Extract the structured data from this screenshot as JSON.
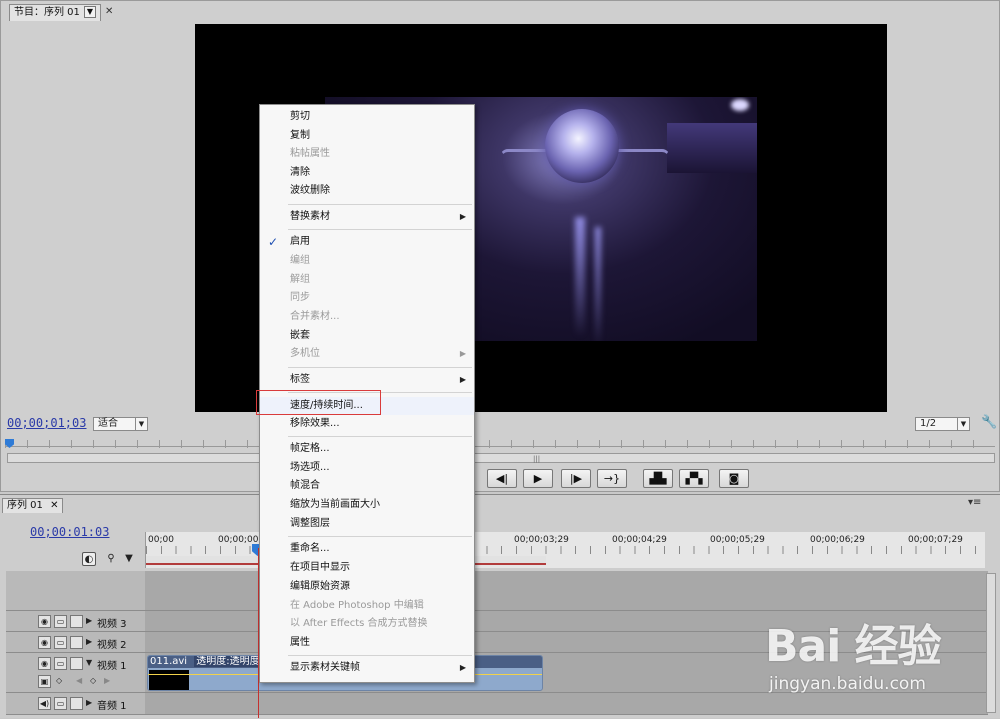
{
  "program_monitor": {
    "tab_title": "节目：序列 01",
    "timecode": "00;00;01;03",
    "fit_dropdown": "适合",
    "quality_dropdown": "1/2"
  },
  "transport": {
    "buttons": [
      "step-back",
      "play",
      "step-forward",
      "shuttle",
      "lift",
      "extract",
      "export-frame"
    ]
  },
  "timeline": {
    "tab_title": "序列 01",
    "timecode": "00;00:01:03",
    "ruler_labels": [
      "00;00",
      "00;00;00;29",
      "00;00;03;29",
      "00;00;04;29",
      "00;00;05;29",
      "00;00;06;29",
      "00;00;07;29"
    ],
    "tracks": [
      {
        "name": "视频 3"
      },
      {
        "name": "视频 2"
      },
      {
        "name": "视频 1"
      },
      {
        "name": "音频 1"
      }
    ],
    "clip": {
      "name": "011.avi",
      "effect": "透明度:透明度"
    }
  },
  "context_menu": {
    "items": [
      {
        "label": "剪切",
        "enabled": true
      },
      {
        "label": "复制",
        "enabled": true
      },
      {
        "label": "粘帖属性",
        "enabled": false
      },
      {
        "label": "清除",
        "enabled": true
      },
      {
        "label": "波纹删除",
        "enabled": true
      },
      {
        "label": "替换素材",
        "enabled": true,
        "submenu": true
      },
      {
        "label": "启用",
        "enabled": true,
        "checked": true
      },
      {
        "label": "编组",
        "enabled": false
      },
      {
        "label": "解组",
        "enabled": false
      },
      {
        "label": "同步",
        "enabled": false
      },
      {
        "label": "合并素材...",
        "enabled": false
      },
      {
        "label": "嵌套",
        "enabled": true
      },
      {
        "label": "多机位",
        "enabled": false,
        "submenu": true
      },
      {
        "label": "标签",
        "enabled": true,
        "submenu": true
      },
      {
        "label": "速度/持续时间...",
        "enabled": true,
        "highlighted": true
      },
      {
        "label": "移除效果...",
        "enabled": true
      },
      {
        "label": "帧定格...",
        "enabled": true
      },
      {
        "label": "场选项...",
        "enabled": true
      },
      {
        "label": "帧混合",
        "enabled": true
      },
      {
        "label": "缩放为当前画面大小",
        "enabled": true
      },
      {
        "label": "调整图层",
        "enabled": true
      },
      {
        "label": "重命名...",
        "enabled": true
      },
      {
        "label": "在项目中显示",
        "enabled": true
      },
      {
        "label": "编辑原始资源",
        "enabled": true
      },
      {
        "label": "在 Adobe Photoshop 中编辑",
        "enabled": false
      },
      {
        "label": "以 After Effects 合成方式替换",
        "enabled": false
      },
      {
        "label": "属性",
        "enabled": true
      },
      {
        "label": "显示素材关键帧",
        "enabled": true,
        "submenu": true
      }
    ]
  },
  "watermark": {
    "logo": "Bai 经验",
    "url": "jingyan.baidu.com"
  },
  "icons": {
    "checkmark": "check-icon",
    "submenu": "submenu-arrow-icon",
    "wrench": "wrench-icon"
  },
  "colors": {
    "timecode": "#2a3aa8",
    "playhead": "#2f7bd6",
    "playhead_line": "#c4312f",
    "highlight_box": "#d93b3b"
  }
}
